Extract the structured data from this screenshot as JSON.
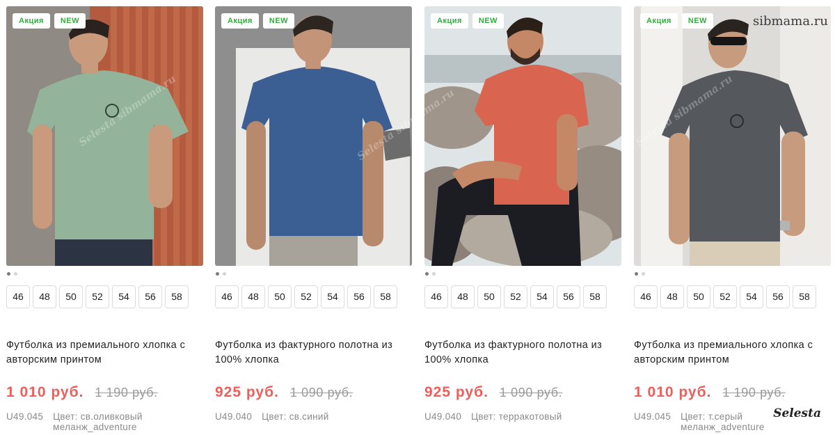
{
  "products": [
    {
      "badges": [
        "Акция",
        "NEW"
      ],
      "sizes": [
        "46",
        "48",
        "50",
        "52",
        "54",
        "56",
        "58"
      ],
      "title": "Футболка из премиального хлопка с авторским принтом",
      "price_new": "1 010 руб.",
      "price_old": "1 190 руб.",
      "sku": "U49.045",
      "color": "Цвет: св.оливковый меланж_adventure",
      "tee_color": "#93b39a",
      "photo_scene": "wood-wall"
    },
    {
      "badges": [
        "Акция",
        "NEW"
      ],
      "sizes": [
        "46",
        "48",
        "50",
        "52",
        "54",
        "56",
        "58"
      ],
      "title": "Футболка из фактурного полотна из 100% хлопка",
      "price_new": "925 руб.",
      "price_old": "1 090 руб.",
      "sku": "U49.040",
      "color": "Цвет: св.синий",
      "tee_color": "#3c5f93",
      "photo_scene": "grey-studio"
    },
    {
      "badges": [
        "Акция",
        "NEW"
      ],
      "sizes": [
        "46",
        "48",
        "50",
        "52",
        "54",
        "56",
        "58"
      ],
      "title": "Футболка из фактурного полотна из 100% хлопка",
      "price_new": "925 руб.",
      "price_old": "1 090 руб.",
      "sku": "U49.040",
      "color": "Цвет: терракотовый",
      "tee_color": "#d9644f",
      "photo_scene": "rocks-seaside"
    },
    {
      "badges": [
        "Акция",
        "NEW"
      ],
      "sizes": [
        "46",
        "48",
        "50",
        "52",
        "54",
        "56",
        "58"
      ],
      "title": "Футболка из премиального хлопка с авторским принтом",
      "price_new": "1 010 руб.",
      "price_old": "1 190 руб.",
      "sku": "U49.045",
      "color": "Цвет: т.серый меланж_adventure",
      "tee_color": "#55595e",
      "photo_scene": "white-wall"
    }
  ],
  "watermarks": {
    "site": "sibmama.ru",
    "brand": "Selesta",
    "diagonal": "Selesta sibmama.ru"
  },
  "colors": {
    "accent_price": "#ee5e5a",
    "badge_text": "#2fae3b"
  }
}
